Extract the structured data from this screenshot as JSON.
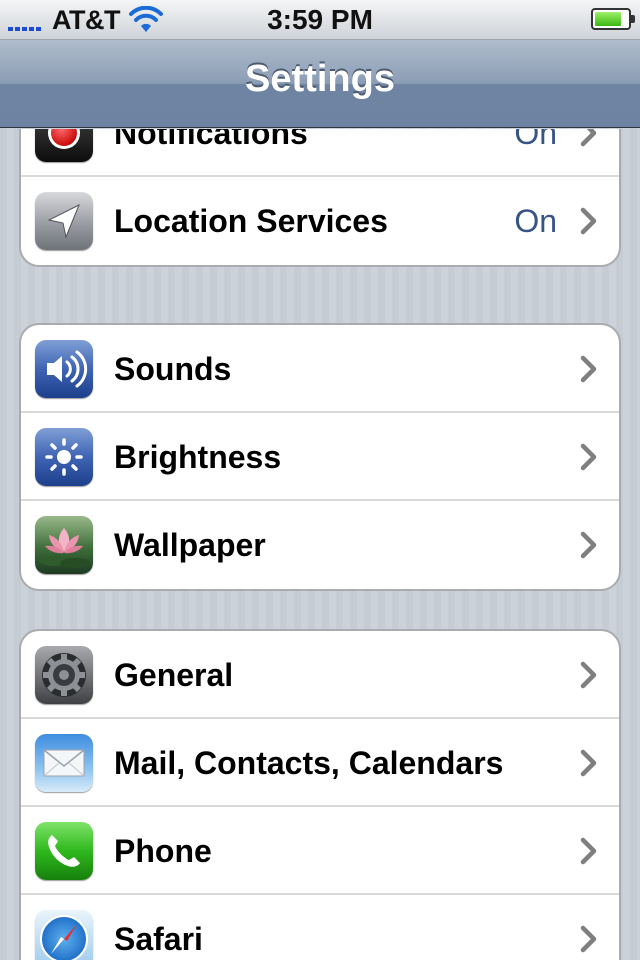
{
  "status_bar": {
    "carrier": "AT&T",
    "time": "3:59 PM",
    "signal_bars": 5,
    "battery_level": 0.8
  },
  "nav_bar": {
    "title": "Settings"
  },
  "groups": [
    {
      "rows": [
        {
          "label": "Notifications",
          "value": "On",
          "icon": "notifications-icon"
        },
        {
          "label": "Location Services",
          "value": "On",
          "icon": "location-arrow-icon"
        }
      ]
    },
    {
      "rows": [
        {
          "label": "Sounds",
          "value": "",
          "icon": "speaker-icon"
        },
        {
          "label": "Brightness",
          "value": "",
          "icon": "sun-icon"
        },
        {
          "label": "Wallpaper",
          "value": "",
          "icon": "flower-icon"
        }
      ]
    },
    {
      "rows": [
        {
          "label": "General",
          "value": "",
          "icon": "gear-icon"
        },
        {
          "label": "Mail, Contacts, Calendars",
          "value": "",
          "icon": "envelope-icon"
        },
        {
          "label": "Phone",
          "value": "",
          "icon": "phone-handset-icon"
        },
        {
          "label": "Safari",
          "value": "",
          "icon": "compass-icon"
        }
      ]
    }
  ],
  "colors": {
    "value_text": "#385487",
    "nav_bar": "#6e84a2",
    "background": "#c5ccd4"
  }
}
